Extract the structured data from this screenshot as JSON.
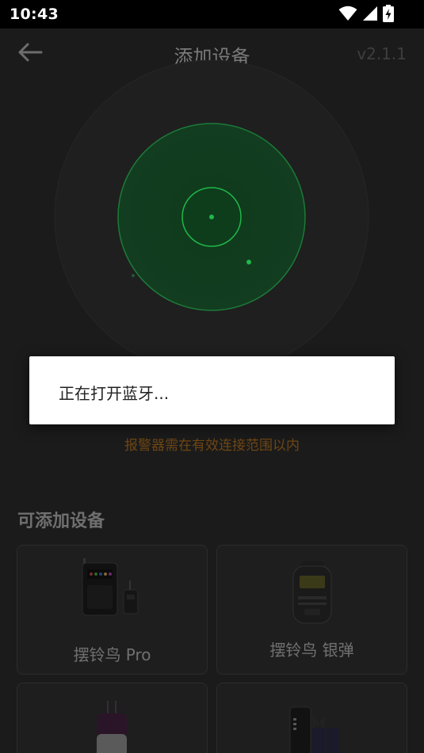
{
  "status_bar": {
    "time": "10:43",
    "icons": [
      "wifi-icon",
      "signal-icon",
      "battery-charging-icon"
    ]
  },
  "header": {
    "back_icon": "arrow-left-icon",
    "title": "添加设备",
    "version": "v2.1.1"
  },
  "scan": {
    "hint": "报警器需在有效连接范围以内"
  },
  "devices": {
    "section_title": "可添加设备",
    "items": [
      {
        "label": "摆铃鸟 Pro"
      },
      {
        "label": "摆铃鸟 银弹"
      },
      {
        "label": ""
      },
      {
        "label": ""
      }
    ]
  },
  "dialog": {
    "message": "正在打开蓝牙..."
  },
  "colors": {
    "radar_green": "#1fb84a",
    "hint_orange": "#6e4614",
    "background": "#1b1b1b"
  }
}
